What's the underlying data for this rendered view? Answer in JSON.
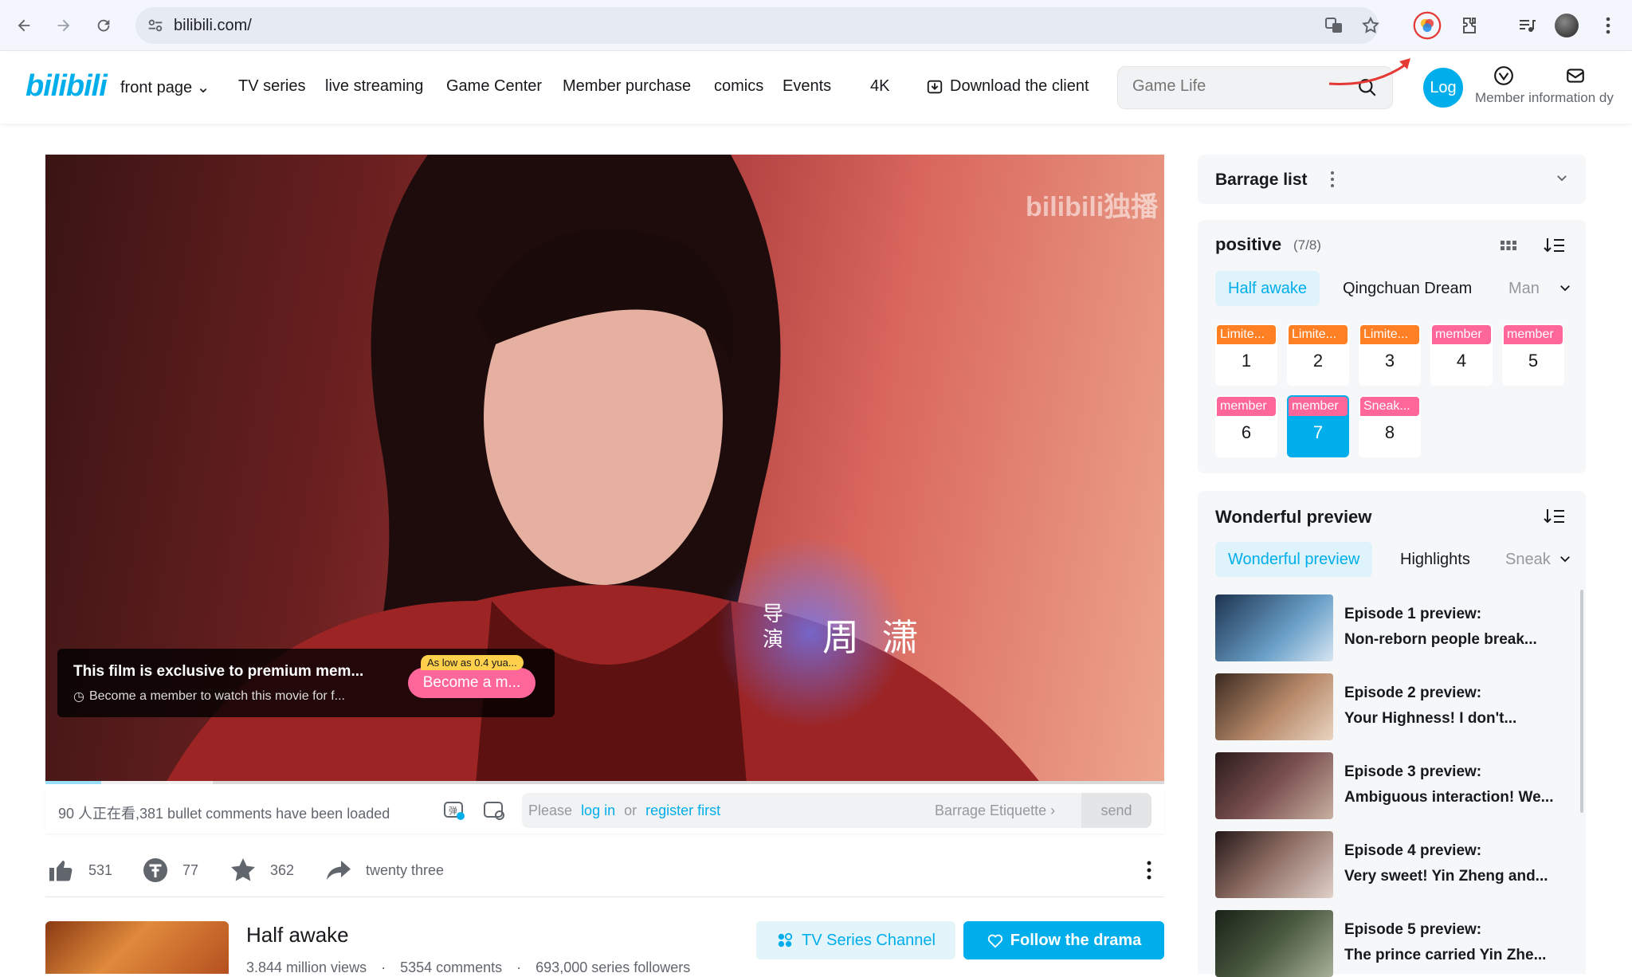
{
  "browser": {
    "url": "bilibili.com/"
  },
  "header": {
    "logo": "bilibili",
    "nav": [
      "front page",
      "TV series",
      "live streaming",
      "Game Center",
      "Member purchase",
      "comics",
      "Events",
      "4K"
    ],
    "download": "Download the client",
    "search_placeholder": "Game Life",
    "login": "Log",
    "member_info": "Member information dy"
  },
  "player": {
    "watermark": "bilibili独播",
    "credit_role": "导演",
    "credit_name": "周 潇",
    "banner_title": "This film is exclusive to premium mem...",
    "banner_sub": "Become a member to watch this movie for f...",
    "promo_badge": "As low as 0.4 yua...",
    "promo_button": "Become a m...",
    "progress": 0.05
  },
  "danmu": {
    "status": "90 人正在看,381 bullet comments have been loaded",
    "input_please": "Please",
    "input_login": "log in",
    "input_or": "or",
    "input_register": "register first",
    "etiquette": "Barrage Etiquette",
    "send": "send"
  },
  "actions": {
    "like": "531",
    "coin": "77",
    "fav": "362",
    "share": "twenty three"
  },
  "info": {
    "title": "Half awake",
    "views": "3.844 million views",
    "comments": "5354 comments",
    "followers": "693,000 series followers",
    "channel_btn": "TV Series Channel",
    "follow_btn": "Follow the drama"
  },
  "barrage": {
    "title": "Barrage list"
  },
  "episodes": {
    "title": "positive",
    "count": "(7/8)",
    "tabs": [
      "Half awake",
      "Qingchuan Dream",
      "Man"
    ],
    "items": [
      {
        "tag": "Limite...",
        "num": "1",
        "tag_color": "#ff7f24"
      },
      {
        "tag": "Limite...",
        "num": "2",
        "tag_color": "#ff7f24"
      },
      {
        "tag": "Limite...",
        "num": "3",
        "tag_color": "#ff7f24"
      },
      {
        "tag": "member",
        "num": "4",
        "tag_color": "#ff6699"
      },
      {
        "tag": "member",
        "num": "5",
        "tag_color": "#ff6699"
      },
      {
        "tag": "member",
        "num": "6",
        "tag_color": "#ff6699"
      },
      {
        "tag": "member",
        "num": "7",
        "tag_color": "#ff6699"
      },
      {
        "tag": "Sneak...",
        "num": "8",
        "tag_color": "#ff6699"
      }
    ],
    "active_index": 6
  },
  "previews": {
    "title": "Wonderful preview",
    "tabs": [
      "Wonderful preview",
      "Highlights",
      "Sneak"
    ],
    "items": [
      {
        "title": "Episode 1 preview:",
        "desc": "Non-reborn people break..."
      },
      {
        "title": "Episode 2 preview:",
        "desc": "Your Highness! I don't..."
      },
      {
        "title": "Episode 3 preview:",
        "desc": "Ambiguous interaction! We..."
      },
      {
        "title": "Episode 4 preview:",
        "desc": "Very sweet! Yin Zheng and..."
      },
      {
        "title": "Episode 5 preview:",
        "desc": "The prince carried Yin Zhe..."
      }
    ]
  },
  "colors": {
    "accent": "#00aeec",
    "pink": "#ff6699",
    "orange": "#ff7f24",
    "text": "#18191c",
    "muted": "#61666d"
  }
}
